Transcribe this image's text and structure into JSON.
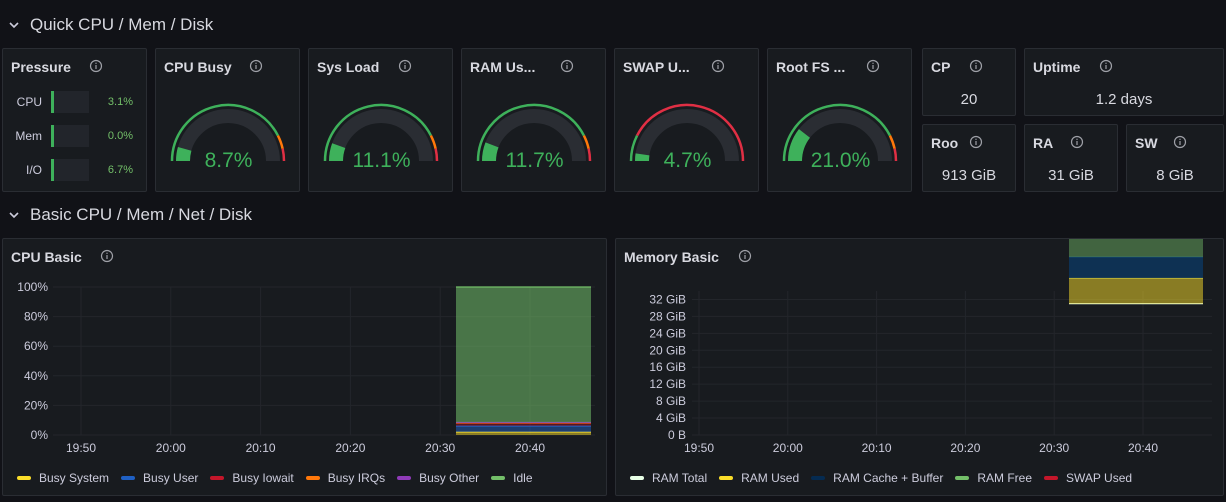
{
  "rows": [
    {
      "title": "Quick CPU / Mem / Disk"
    },
    {
      "title": "Basic CPU / Mem / Net / Disk"
    }
  ],
  "pressure": {
    "title": "Pressure",
    "items": [
      {
        "label": "CPU",
        "value": "3.1%"
      },
      {
        "label": "Mem",
        "value": "0.0%"
      },
      {
        "label": "I/O",
        "value": "6.7%"
      }
    ]
  },
  "gauges": [
    {
      "title": "CPU Busy",
      "value": "8.7%",
      "fraction": 0.087,
      "color": "#3eb15b"
    },
    {
      "title": "Sys Load",
      "value": "11.1%",
      "fraction": 0.111,
      "color": "#3eb15b"
    },
    {
      "title": "RAM Us...",
      "value": "11.7%",
      "fraction": 0.117,
      "color": "#3eb15b"
    },
    {
      "title": "SWAP U...",
      "value": "4.7%",
      "fraction": 0.047,
      "color": "#3eb15b"
    },
    {
      "title": "Root FS ...",
      "value": "21.0%",
      "fraction": 0.21,
      "color": "#3eb15b"
    }
  ],
  "stats": {
    "cpu": {
      "title": "CP",
      "value": "20"
    },
    "uptime": {
      "title": "Uptime",
      "value": "1.2 days"
    },
    "rootfs": {
      "title": "Roo",
      "value": "913 GiB"
    },
    "ram": {
      "title": "RA",
      "value": "31 GiB"
    },
    "swap": {
      "title": "SW",
      "value": "8 GiB"
    }
  },
  "cpu_basic": {
    "title": "CPU Basic",
    "legend": [
      {
        "name": "Busy System",
        "color": "#fade2a"
      },
      {
        "name": "Busy User",
        "color": "#1f60c4"
      },
      {
        "name": "Busy Iowait",
        "color": "#c4162a"
      },
      {
        "name": "Busy IRQs",
        "color": "#ff780a"
      },
      {
        "name": "Busy Other",
        "color": "#8f3bb8"
      },
      {
        "name": "Idle",
        "color": "#73bf69"
      }
    ]
  },
  "memory_basic": {
    "title": "Memory Basic",
    "legend": [
      {
        "name": "RAM Total",
        "color": "#e8ffe6"
      },
      {
        "name": "RAM Used",
        "color": "#fade2a"
      },
      {
        "name": "RAM Cache + Buffer",
        "color": "#052b51"
      },
      {
        "name": "RAM Free",
        "color": "#73bf69"
      },
      {
        "name": "SWAP Used",
        "color": "#c4162a"
      }
    ]
  },
  "chart_data": [
    {
      "type": "area",
      "title": "CPU Basic",
      "x_ticks": [
        "19:50",
        "20:00",
        "20:10",
        "20:20",
        "20:30",
        "20:40"
      ],
      "y_ticks": [
        "0%",
        "20%",
        "40%",
        "60%",
        "80%",
        "100%"
      ],
      "ylim": [
        0,
        100
      ],
      "data_window": [
        "20:32",
        "20:47"
      ],
      "series": [
        {
          "name": "Busy System",
          "values": [
            2,
            2,
            2,
            2
          ]
        },
        {
          "name": "Busy User",
          "values": [
            4,
            4,
            4,
            4
          ]
        },
        {
          "name": "Busy Iowait",
          "values": [
            2,
            2,
            2,
            2
          ]
        },
        {
          "name": "Busy IRQs",
          "values": [
            0.3,
            0.3,
            0.3,
            0.3
          ]
        },
        {
          "name": "Busy Other",
          "values": [
            0.2,
            0.2,
            0.2,
            0.2
          ]
        },
        {
          "name": "Idle",
          "values": [
            91.5,
            91.5,
            91.5,
            91.5
          ]
        }
      ],
      "grid": true,
      "legend": "bottom"
    },
    {
      "type": "area",
      "title": "Memory Basic",
      "x_ticks": [
        "19:50",
        "20:00",
        "20:10",
        "20:20",
        "20:30",
        "20:40"
      ],
      "y_ticks": [
        "0 B",
        "4 GiB",
        "8 GiB",
        "12 GiB",
        "16 GiB",
        "20 GiB",
        "24 GiB",
        "28 GiB",
        "32 GiB"
      ],
      "ylim": [
        0,
        34
      ],
      "data_window": [
        "20:32",
        "20:47"
      ],
      "series": [
        {
          "name": "RAM Total",
          "values": [
            31,
            31,
            31,
            31
          ]
        },
        {
          "name": "RAM Used",
          "values": [
            6,
            6,
            6,
            6
          ]
        },
        {
          "name": "RAM Cache + Buffer",
          "values": [
            5,
            5,
            5,
            5
          ]
        },
        {
          "name": "RAM Free",
          "values": [
            20,
            20,
            20,
            20
          ]
        },
        {
          "name": "SWAP Used",
          "values": [
            0.1,
            0.1,
            0.1,
            0.1
          ]
        }
      ],
      "grid": true,
      "legend": "bottom"
    }
  ]
}
